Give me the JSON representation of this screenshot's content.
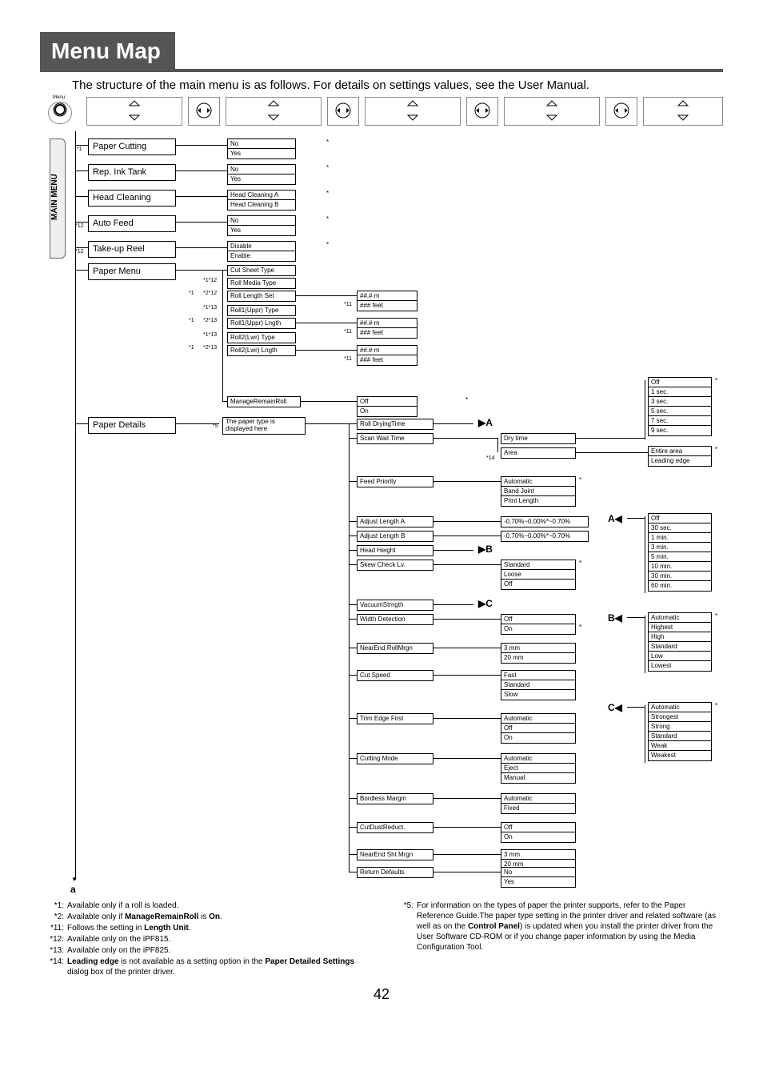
{
  "title": "Menu Map",
  "intro": "The structure of the main menu is as follows. For details on settings values, see the User Manual.",
  "menuLabel": "Menu",
  "mainMenu": "MAIN MENU",
  "pageNumber": "42",
  "contLabel": "a",
  "col1": {
    "paperCutting": "Paper Cutting",
    "repInkTank": "Rep. Ink Tank",
    "headCleaning": "Head Cleaning",
    "autoFeed": "Auto Feed",
    "takeUpReel": "Take-up Reel",
    "paperMenu": "Paper Menu",
    "paperDetails": "Paper Details"
  },
  "notes": {
    "n1": "*1",
    "n12": "*12",
    "n1_12": "*1*12",
    "n2_12": "*2*12",
    "n1_13": "*1*13",
    "n2_13": "*2*13",
    "n5": "*5",
    "n11": "*11",
    "n14": "*14"
  },
  "col2": {
    "no": "No",
    "yes": "Yes",
    "headA": "Head Cleaning A",
    "headB": "Head Cleaning B",
    "disable": "Disable",
    "enable": "Enable",
    "cutSheetType": "Cut Sheet Type",
    "rollMediaType": "Roll Media Type",
    "rollLengthSet": "Roll Length Set",
    "roll1UpprType": "Roll1(Uppr) Type",
    "roll1UpprLngth": "Roll1(Uppr) Lngth",
    "roll2LwrType": "Roll2(Lwr) Type",
    "roll2LwrLngth": "Roll2(Lwr) Lngth",
    "manageRemainRoll": "ManageRemainRoll",
    "paperTypeDisplayed": "The paper type is displayed here"
  },
  "col3": {
    "mm": "##.# m",
    "ftt": "### feet",
    "off": "Off",
    "on": "On",
    "rollDrying": "Roll DryingTime",
    "scanWait": "Scan Wait Time",
    "feedPriority": "Feed Priority",
    "adjLenA": "Adjust Length A",
    "adjLenB": "Adjust Length B",
    "headHeight": "Head Height",
    "skewCheck": "Skew Check Lv.",
    "vacuum": "VacuumStrngth",
    "widthDet": "Width Detection",
    "nearEndRoll": "NearEnd RollMrgn",
    "cutSpeed": "Cut Speed",
    "trimEdge": "Trim Edge First",
    "cuttingMode": "Cutting Mode",
    "bordless": "Bordless Margin",
    "cutDust": "CutDustReduct.",
    "nearEndSht": "NearEnd Sht Mrgn",
    "returnDef": "Return Defaults"
  },
  "col4": {
    "dryTime": "Dry time",
    "area": "Area",
    "automatic": "Automatic",
    "bandJoint": "Band Joint",
    "printLength": "Print Length",
    "range": "-0.70%~0.00%*~0.70%",
    "standard": "Standard",
    "loose": "Loose",
    "off": "Off",
    "on": "On",
    "three": "3 mm",
    "twenty": "20 mm",
    "fast": "Fast",
    "slow": "Slow",
    "eject": "Eject",
    "manual": "Manual",
    "fixed": "Fixed",
    "no": "No",
    "yes": "Yes"
  },
  "col5A": {
    "off": "Off",
    "sec1": "1 sec.",
    "sec3": "3 sec.",
    "sec5": "5 sec.",
    "sec7": "7 sec.",
    "sec9": "9 sec.",
    "entire": "Entire area",
    "leading": "Leading edge"
  },
  "col5B": {
    "off": "Off",
    "sec30": "30 sec.",
    "min1": "1 min.",
    "min3": "3 min.",
    "min5": "5 min.",
    "min10": "10 min.",
    "min30": "30 min.",
    "min60": "60 min."
  },
  "col5C": {
    "automatic": "Automatic",
    "highest": "Highest",
    "high": "High",
    "standard": "Standard",
    "low": "Low",
    "lowest": "Lowest"
  },
  "col5D": {
    "automatic": "Automatic",
    "strongest": "Strongest",
    "strong": "Strong",
    "standard": "Standard",
    "weak": "Weak",
    "weakest": "Weakest"
  },
  "letters": {
    "A": "A",
    "B": "B",
    "C": "C",
    "Ar": "A",
    "Br": "B",
    "Cr": "C"
  },
  "footnotes": {
    "left": [
      {
        "lbl": "*1:",
        "txt": "Available only if a roll is loaded."
      },
      {
        "lbl": "*2:",
        "txt": "Available only if <b>ManageRemainRoll</b> is <b>On</b>."
      },
      {
        "lbl": "*11:",
        "txt": "Follows the setting in <b>Length Unit</b>."
      },
      {
        "lbl": "*12:",
        "txt": "Available only on the iPF815."
      },
      {
        "lbl": "*13:",
        "txt": "Available only on the iPF825."
      },
      {
        "lbl": "*14:",
        "txt": "<b>Leading edge</b> is not available as a setting option in the <b>Paper Detailed Settings</b> dialog box of the printer driver."
      }
    ],
    "right": [
      {
        "lbl": "*5:",
        "txt": "For information on the types of paper the printer supports, refer to the Paper Reference Guide.The paper type setting in the printer driver and related software (as well as on the <b>Control Panel</b>) is updated when you install the printer driver from the User Software CD-ROM or if you change paper information by using the Media Configuration Tool."
      }
    ]
  }
}
